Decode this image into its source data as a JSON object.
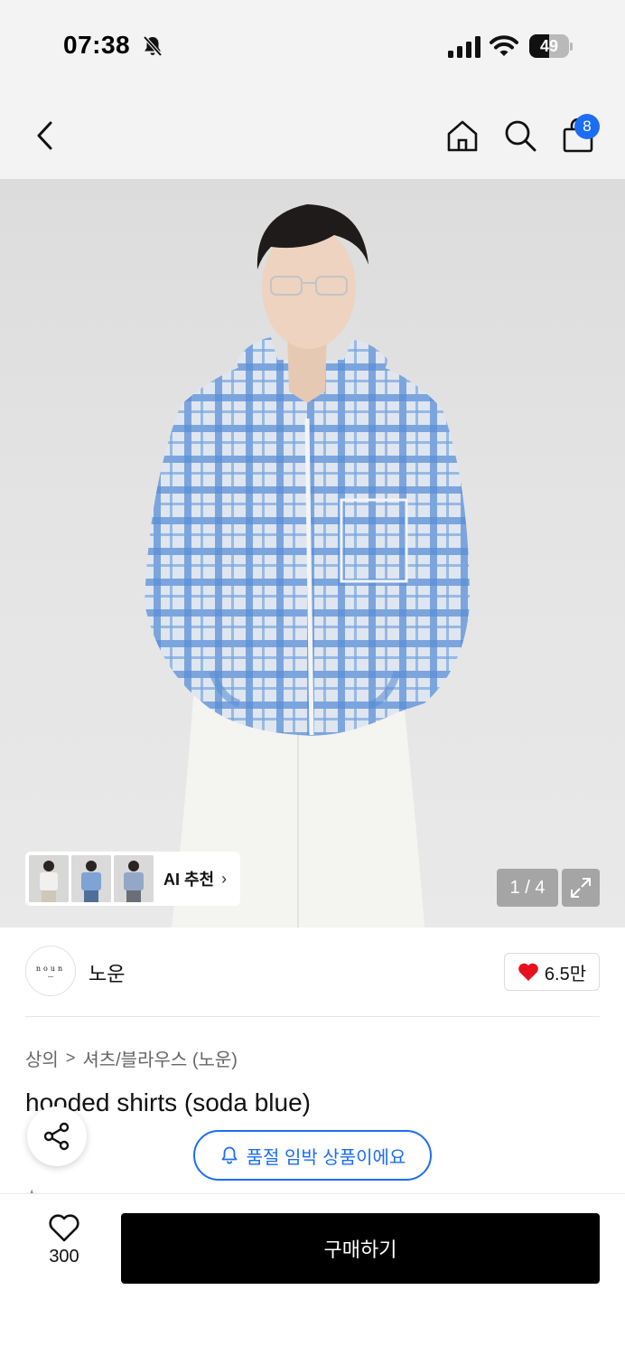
{
  "status_bar": {
    "time": "07:38",
    "battery_percent": "49",
    "battery_level": 0.49
  },
  "nav": {
    "back_icon": "chevron-left-icon",
    "home_icon": "home-icon",
    "search_icon": "search-icon",
    "cart_icon": "shopping-bag-icon",
    "cart_count": "8"
  },
  "gallery": {
    "ai_recommend_label": "AI 추천",
    "ai_recommend_chevron": "›",
    "page_indicator": "1 / 4",
    "expand_icon": "expand-icon"
  },
  "brand": {
    "logo_text": "noun",
    "name": "노운",
    "like_count": "6.5만"
  },
  "breadcrumb": {
    "category": "상의",
    "separator": ">",
    "subcategory": "셔츠/블라우스 (노운)"
  },
  "product": {
    "title": "hooded shirts (soda blue)"
  },
  "floating": {
    "share_icon": "share-icon",
    "soldout_notice": "품절 임박 상품이에요",
    "bell_icon": "bell-icon"
  },
  "bottom_bar": {
    "wish_count": "300",
    "buy_label": "구매하기"
  },
  "colors": {
    "accent_blue": "#1b6ef3",
    "buy_button": "#000000",
    "like_heart": "#e8101f"
  }
}
